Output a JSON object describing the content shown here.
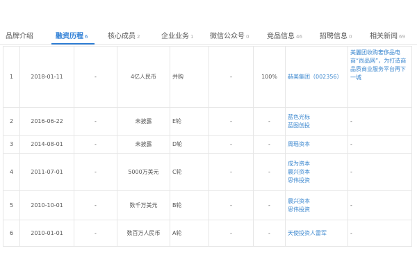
{
  "tabs": [
    {
      "label": "品牌介绍",
      "count": ""
    },
    {
      "label": "融资历程",
      "count": "6"
    },
    {
      "label": "核心成员",
      "count": "2"
    },
    {
      "label": "企业业务",
      "count": "1"
    },
    {
      "label": "微信公众号",
      "count": "0"
    },
    {
      "label": "竞品信息",
      "count": "46"
    },
    {
      "label": "招聘信息",
      "count": "0"
    },
    {
      "label": "相关新闻",
      "count": "69"
    }
  ],
  "rows": [
    {
      "no": "1",
      "date": "2018-01-11",
      "valuation": "-",
      "amount": "4亿人民币",
      "round": "并购",
      "ratio": "-",
      "share": "100%",
      "investors": [
        "赫美集团（002356）"
      ],
      "news": [
        "美麗团收购奢侈品电商“尚品网”，为打造商品质商业服务平台再下一城"
      ]
    },
    {
      "no": "2",
      "date": "2016-06-22",
      "valuation": "-",
      "amount": "未披露",
      "round": "E轮",
      "ratio": "-",
      "share": "-",
      "investors": [
        "蓝色光标",
        "蓝图创投"
      ],
      "news": [
        "-"
      ]
    },
    {
      "no": "3",
      "date": "2014-08-01",
      "valuation": "-",
      "amount": "未披露",
      "round": "D轮",
      "ratio": "-",
      "share": "-",
      "investors": [
        "周瑶资本"
      ],
      "news": [
        "-"
      ]
    },
    {
      "no": "4",
      "date": "2011-07-01",
      "valuation": "-",
      "amount": "5000万美元",
      "round": "C轮",
      "ratio": "-",
      "share": "-",
      "investors": [
        "成为资本",
        "晨兴资本",
        "思伟投资"
      ],
      "news": [
        "-"
      ]
    },
    {
      "no": "5",
      "date": "2010-10-01",
      "valuation": "-",
      "amount": "数千万美元",
      "round": "B轮",
      "ratio": "-",
      "share": "-",
      "investors": [
        "晨兴资本",
        "思伟投资"
      ],
      "news": [
        "-"
      ]
    },
    {
      "no": "6",
      "date": "2010-01-01",
      "valuation": "-",
      "amount": "数百万人民币",
      "round": "A轮",
      "ratio": "-",
      "share": "-",
      "investors": [
        "天使投资人雷军"
      ],
      "news": [
        "-"
      ]
    }
  ],
  "colors": {
    "accent": "#2f7fd6",
    "link": "#3b87cf",
    "border": "#e6e6e6"
  }
}
